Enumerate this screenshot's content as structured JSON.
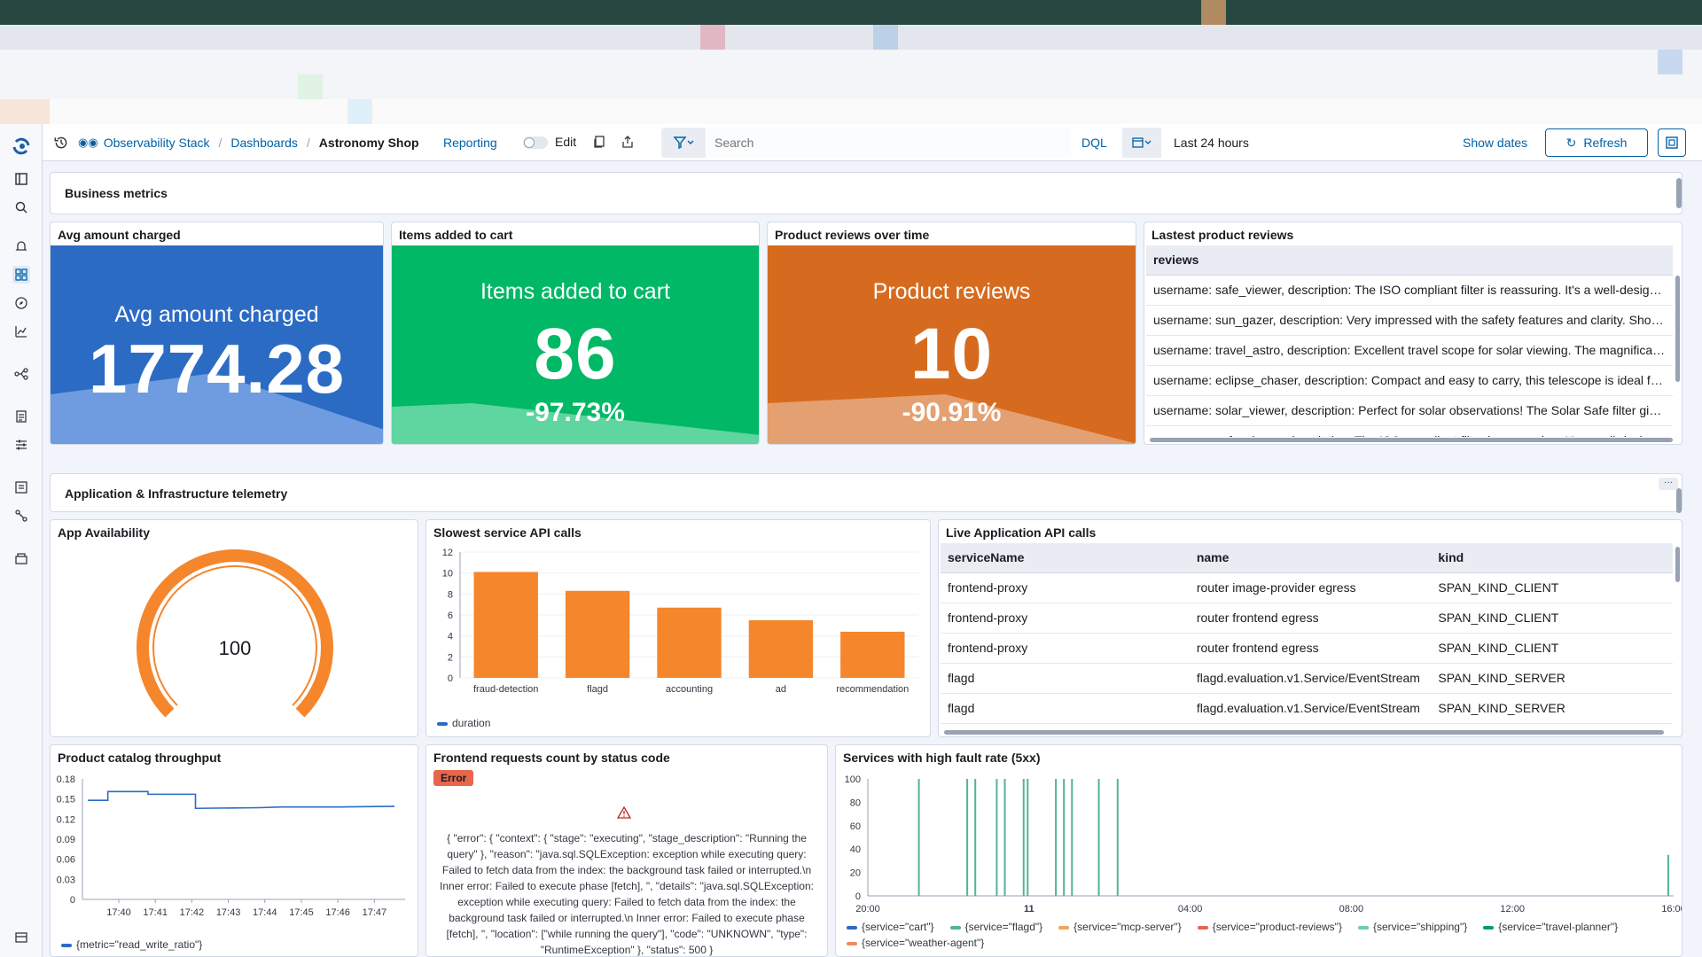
{
  "topbar": {
    "breadcrumbs": [
      "Observability Stack",
      "Dashboards",
      "Astronomy Shop"
    ],
    "reporting_label": "Reporting",
    "edit_label": "Edit",
    "search_placeholder": "Search",
    "dql_label": "DQL",
    "time_range": "Last 24 hours",
    "show_dates_label": "Show dates",
    "refresh_label": "Refresh"
  },
  "sections": {
    "business": "Business metrics",
    "telemetry": "Application & Infrastructure telemetry"
  },
  "metrics": [
    {
      "panel_title": "Avg amount charged",
      "label": "Avg amount charged",
      "value": "1774.28",
      "change": "",
      "color": "#2b6bc4",
      "area_color": "#6f9be0"
    },
    {
      "panel_title": "Items added to cart",
      "label": "Items added to cart",
      "value": "86",
      "change": "-97.73%",
      "color": "#00b865",
      "area_color": "#5fd5a0"
    },
    {
      "panel_title": "Product reviews over time",
      "label": "Product reviews",
      "value": "10",
      "change": "-90.91%",
      "color": "#d66b1f",
      "area_color": "#e5a071"
    }
  ],
  "reviews": {
    "title": "Lastest product reviews",
    "header": "reviews",
    "rows": [
      "username: safe_viewer, description: The ISO compliant filter is reassuring. It's a well-designed product.",
      "username: sun_gazer, description: Very impressed with the safety features and clarity. Should be standard.",
      "username: travel_astro, description: Excellent travel scope for solar viewing. The magnification is perfect.",
      "username: eclipse_chaser, description: Compact and easy to carry, this telescope is ideal for eclipses.",
      "username: solar_viewer, description: Perfect for solar observations! The Solar Safe filter gives great views.",
      "username: safe_viewer, description: The ISO compliant filter is reassuring. It's a well-designed product."
    ]
  },
  "availability": {
    "title": "App Availability",
    "value": "100",
    "fraction": 1.0,
    "color": "#f5862c"
  },
  "slowest": {
    "title": "Slowest service API calls",
    "legend": "duration"
  },
  "live_calls": {
    "title": "Live Application API calls",
    "columns": [
      "serviceName",
      "name",
      "kind"
    ],
    "rows": [
      [
        "frontend-proxy",
        "router image-provider egress",
        "SPAN_KIND_CLIENT"
      ],
      [
        "frontend-proxy",
        "router frontend egress",
        "SPAN_KIND_CLIENT"
      ],
      [
        "frontend-proxy",
        "router frontend egress",
        "SPAN_KIND_CLIENT"
      ],
      [
        "flagd",
        "flagd.evaluation.v1.Service/EventStream",
        "SPAN_KIND_SERVER"
      ],
      [
        "flagd",
        "flagd.evaluation.v1.Service/EventStream",
        "SPAN_KIND_SERVER"
      ]
    ]
  },
  "catalog": {
    "title": "Product catalog throughput",
    "legend": "{metric=\"read_write_ratio\"}"
  },
  "frontend_requests": {
    "title": "Frontend requests count by status code",
    "badge": "Error",
    "message": "{ \"error\": { \"context\": { \"stage\": \"executing\", \"stage_description\": \"Running the query\" }, \"reason\": \"java.sql.SQLException: exception while executing query: Failed to fetch data from the index: the background task failed or interrupted.\\n Inner error: Failed to execute phase [fetch], \", \"details\": \"java.sql.SQLException: exception while executing query: Failed to fetch data from the index: the background task failed or interrupted.\\n Inner error: Failed to execute phase [fetch], \", \"location\": [\"while running the query\"], \"code\": \"UNKNOWN\", \"type\": \"RuntimeException\" }, \"status\": 500 }"
  },
  "fault": {
    "title": "Services with high fault rate (5xx)"
  },
  "chart_data": [
    {
      "type": "bar",
      "title": "Slowest service API calls",
      "categories": [
        "fraud-detection",
        "flagd",
        "accounting",
        "ad",
        "recommendation"
      ],
      "series": [
        {
          "name": "duration",
          "values": [
            10.1,
            8.3,
            6.7,
            5.5,
            4.4
          ],
          "color": "#f5862c"
        }
      ],
      "ylim": [
        0,
        12
      ],
      "yticks": [
        0,
        2,
        4,
        6,
        8,
        10,
        12
      ]
    },
    {
      "type": "line",
      "title": "Product catalog throughput",
      "x": [
        "17:40",
        "17:41",
        "17:42",
        "17:43",
        "17:44",
        "17:45",
        "17:46",
        "17:47"
      ],
      "x_values": [
        17.6,
        17.7,
        17.8,
        17.9,
        18.0,
        18.1,
        18.2,
        18.3,
        18.4
      ],
      "series": [
        {
          "name": "{metric=\"read_write_ratio\"}",
          "points": [
            [
              0,
              0.148
            ],
            [
              0.55,
              0.148
            ],
            [
              0.55,
              0.161
            ],
            [
              1.65,
              0.161
            ],
            [
              1.65,
              0.157
            ],
            [
              2.95,
              0.157
            ],
            [
              2.95,
              0.136
            ],
            [
              4.7,
              0.137
            ],
            [
              5.3,
              0.138
            ],
            [
              6.9,
              0.138
            ],
            [
              8.4,
              0.139
            ]
          ],
          "color": "#2b6bc4"
        }
      ],
      "ylim": [
        0,
        0.18
      ],
      "yticks": [
        0,
        0.03,
        0.06,
        0.09,
        0.12,
        0.15,
        0.18
      ]
    },
    {
      "type": "line",
      "title": "Services with high fault rate (5xx)",
      "xticks": [
        "20:00",
        "11",
        "04:00",
        "08:00",
        "12:00",
        "16:00"
      ],
      "ylim": [
        0,
        100
      ],
      "yticks": [
        0,
        20,
        40,
        60,
        80,
        100
      ],
      "series": [
        {
          "name": "{service=\"cart\"}",
          "color": "#2b6bc4"
        },
        {
          "name": "{service=\"flagd\"}",
          "color": "#54b399",
          "spike_hours": [
            -4.1,
            -2.3,
            -2.0,
            -1.2,
            -0.9,
            -0.2,
            -0.05,
            1.0,
            1.3,
            1.6,
            2.6,
            3.3,
            23.8
          ],
          "spike_values": [
            100,
            100,
            100,
            100,
            100,
            100,
            100,
            100,
            100,
            100,
            100,
            100,
            35
          ]
        },
        {
          "name": "{service=\"mcp-server\"}",
          "color": "#f5a35c"
        },
        {
          "name": "{service=\"product-reviews\"}",
          "color": "#e7664c"
        },
        {
          "name": "{service=\"shipping\"}",
          "color": "#6dccb1"
        },
        {
          "name": "{service=\"travel-planner\"}",
          "color": "#009e6d"
        },
        {
          "name": "{service=\"weather-agent\"}",
          "color": "#f08a5d"
        }
      ]
    }
  ]
}
